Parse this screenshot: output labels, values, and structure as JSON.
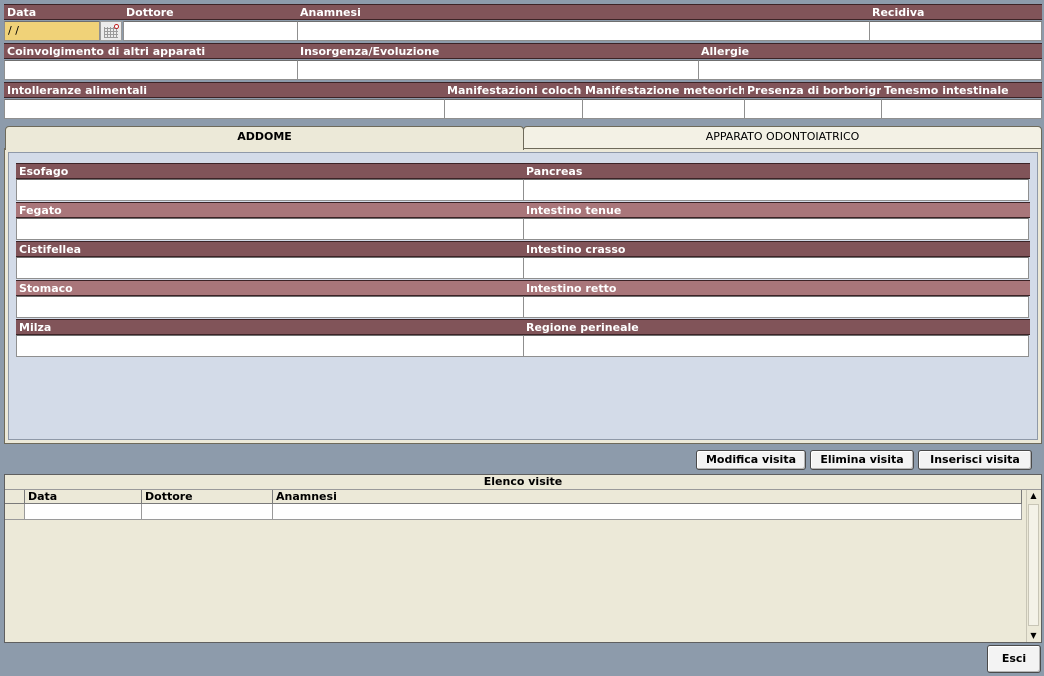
{
  "header": {
    "data_label": "Data",
    "data_value": " / /",
    "dottore_label": "Dottore",
    "anamnesi_label": "Anamnesi",
    "recidiva_label": "Recidiva",
    "coinvolgimento_label": "Coinvolgimento di altri apparati",
    "insorgenza_label": "Insorgenza/Evoluzione",
    "allergie_label": "Allergie",
    "intolleranze_label": "Intolleranze alimentali",
    "manif_coloche_label": "Manifestazioni coloche",
    "manif_meteoriche_label": "Manifestazione meteoriche",
    "borborigmi_label": "Presenza di borborigmi",
    "tenesmo_label": "Tenesmo intestinale"
  },
  "tabs": [
    {
      "label": "ADDOME",
      "active": true
    },
    {
      "label": "APPARATO ODONTOIATRICO",
      "active": false
    }
  ],
  "addome": {
    "left": [
      "Esofago",
      "Fegato",
      "Cistifellea",
      "Stomaco",
      "Milza"
    ],
    "right": [
      "Pancreas",
      "Intestino tenue",
      "Intestino crasso",
      "Intestino retto",
      "Regione perineale"
    ]
  },
  "actions": {
    "modifica": "Modifica visita",
    "elimina": "Elimina visita",
    "inserisci": "Inserisci visita"
  },
  "visits": {
    "title": "Elenco visite",
    "columns": [
      "Data",
      "Dottore",
      "Anamnesi"
    ]
  },
  "esci_label": "Esci",
  "colors": {
    "header_dark": "#815459",
    "header_light": "#a9767a",
    "date_field": "#f0d278",
    "background": "#8d9bab",
    "panel": "#d3dbe8"
  },
  "icons": {
    "calendar": "calendar-icon",
    "scroll_up": "arrow-up-icon",
    "scroll_down": "arrow-down-icon"
  }
}
